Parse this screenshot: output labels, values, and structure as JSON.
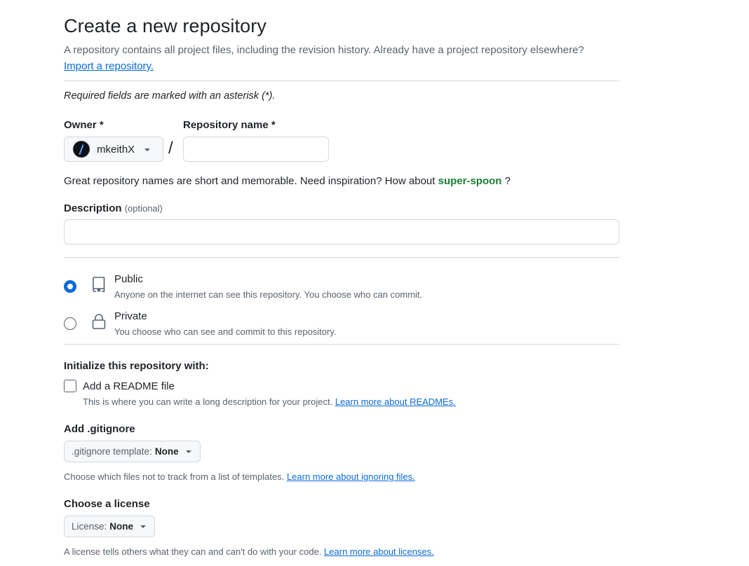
{
  "header": {
    "title": "Create a new repository",
    "subtitle": "A repository contains all project files, including the revision history. Already have a project repository elsewhere?",
    "import_link": "Import a repository."
  },
  "required_note": "Required fields are marked with an asterisk (*).",
  "owner": {
    "label": "Owner *",
    "value": "mkeithX",
    "icon": "avatar"
  },
  "separator": "/",
  "repo_name": {
    "label": "Repository name *",
    "value": "",
    "placeholder": ""
  },
  "hint": {
    "text": "Great repository names are short and memorable. Need inspiration? How about",
    "suggestion": "super-spoon",
    "suffix": "?"
  },
  "description": {
    "label": "Description",
    "optional": "(optional)",
    "value": "",
    "placeholder": ""
  },
  "visibility": {
    "public": {
      "title": "Public",
      "desc": "Anyone on the internet can see this repository. You choose who can commit.",
      "icon": "repo-icon",
      "selected": true
    },
    "private": {
      "title": "Private",
      "desc": "You choose who can see and commit to this repository.",
      "icon": "lock-icon",
      "selected": false
    }
  },
  "initialize": {
    "label": "Initialize this repository with:",
    "readme_title": "Add a README file",
    "readme_desc": "This is where you can write a long description for your project.",
    "readme_link": "Learn more about READMEs.",
    "readme_checked": false
  },
  "gitignore": {
    "label": "Add .gitignore",
    "select_prefix": ".gitignore template:",
    "select_value": "None",
    "desc": "Choose which files not to track from a list of templates.",
    "link": "Learn more about ignoring files."
  },
  "license": {
    "label": "Choose a license",
    "select_prefix": "License:",
    "select_value": "None",
    "desc": "A license tells others what they can and can't do with your code.",
    "link": "Learn more about licenses."
  },
  "colors": {
    "accent": "#0969da",
    "suggestion": "#1a7f37",
    "muted": "#59636e",
    "border": "#d1d9e0"
  }
}
